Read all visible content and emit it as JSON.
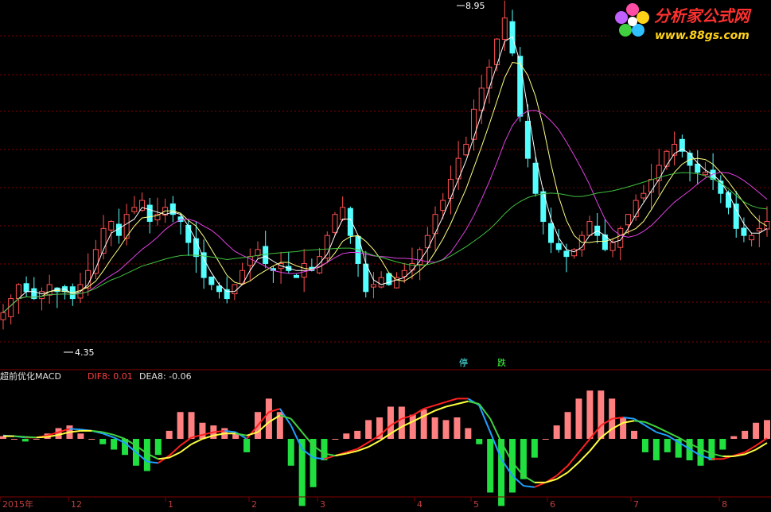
{
  "logo": {
    "title": "分析家公式网",
    "url": "www.88gs.com"
  },
  "price_panel": {
    "high_marker": "8.95",
    "low_marker": "4.35",
    "signals": [
      "停",
      "跌"
    ]
  },
  "macd_panel": {
    "indicator_name": "超前优化MACD",
    "dif_label": "DIF8: 0.01",
    "dea_label": "DEA8: -0.06"
  },
  "time_axis": {
    "labels": [
      "2015年",
      "12",
      "1",
      "2",
      "3",
      "4",
      "5",
      "6",
      "7",
      "8"
    ]
  },
  "colors": {
    "background": "#000000",
    "grid": "#800000",
    "up_candle": "#ff5050",
    "down_candle": "#54ffff",
    "ma_fast": "#ffffff",
    "ma_mid": "#ffff80",
    "ma_slow": "#e040e0",
    "ma_long": "#40c040",
    "dif_up": "#ff2020",
    "dif_down": "#20a0ff",
    "dea_up": "#ffff40",
    "dea_down": "#40d040",
    "hist_pos": "#ff8080",
    "hist_neg": "#20e040"
  },
  "chart_data": {
    "type": "line",
    "title": "",
    "price_extremes": {
      "high": 8.95,
      "low": 4.35
    },
    "price_close_approx": [
      4.7,
      4.9,
      5.1,
      5.0,
      4.9,
      5.0,
      5.1,
      5.0,
      5.0,
      4.9,
      5.1,
      5.3,
      5.6,
      5.9,
      6.0,
      5.8,
      6.1,
      6.2,
      6.3,
      6.0,
      6.1,
      6.2,
      6.1,
      6.0,
      5.7,
      5.5,
      5.2,
      5.1,
      5.0,
      4.9,
      5.1,
      5.3,
      5.5,
      5.6,
      5.4,
      5.3,
      5.4,
      5.3,
      5.2,
      5.4,
      5.3,
      5.5,
      5.8,
      6.1,
      6.2,
      5.8,
      5.4,
      5.0,
      5.1,
      5.2,
      5.1,
      5.2,
      5.3,
      5.4,
      5.6,
      5.8,
      6.1,
      6.3,
      6.6,
      6.9,
      7.1,
      7.6,
      7.9,
      8.2,
      8.6,
      8.9,
      8.4,
      7.5,
      6.9,
      6.4,
      6.0,
      5.7,
      5.6,
      5.5,
      5.6,
      5.8,
      6.0,
      5.8,
      5.6,
      5.7,
      5.9,
      6.1,
      6.3,
      6.4,
      6.6,
      6.8,
      7.0,
      7.1,
      7.0,
      6.8,
      6.7,
      6.7,
      6.6,
      6.4,
      6.2,
      5.9,
      5.8,
      5.8,
      5.9,
      6.0
    ],
    "dif_approx": [
      0.05,
      0.04,
      0.02,
      0.02,
      0.05,
      0.1,
      0.15,
      0.14,
      0.12,
      0.08,
      0.02,
      -0.06,
      -0.2,
      -0.34,
      -0.36,
      -0.25,
      -0.1,
      0.02,
      0.06,
      0.1,
      0.12,
      0.1,
      0.0,
      0.2,
      0.4,
      0.45,
      0.2,
      -0.15,
      -0.28,
      -0.3,
      -0.25,
      -0.2,
      -0.15,
      -0.05,
      0.05,
      0.2,
      0.3,
      0.35,
      0.45,
      0.5,
      0.55,
      0.6,
      0.6,
      0.5,
      0.1,
      -0.3,
      -0.55,
      -0.7,
      -0.72,
      -0.65,
      -0.55,
      -0.4,
      -0.2,
      0.0,
      0.2,
      0.3,
      0.32,
      0.3,
      0.2,
      0.1,
      0.05,
      -0.05,
      -0.15,
      -0.25,
      -0.3,
      -0.3,
      -0.25,
      -0.2,
      -0.1,
      0.01
    ],
    "dea_approx": [
      0.04,
      0.04,
      0.03,
      0.02,
      0.03,
      0.06,
      0.1,
      0.12,
      0.12,
      0.1,
      0.06,
      0.0,
      -0.1,
      -0.22,
      -0.3,
      -0.28,
      -0.2,
      -0.08,
      0.0,
      0.05,
      0.08,
      0.08,
      0.05,
      0.1,
      0.25,
      0.35,
      0.3,
      0.1,
      -0.1,
      -0.22,
      -0.25,
      -0.22,
      -0.18,
      -0.12,
      -0.03,
      0.08,
      0.18,
      0.26,
      0.34,
      0.42,
      0.48,
      0.52,
      0.56,
      0.52,
      0.3,
      -0.05,
      -0.35,
      -0.55,
      -0.65,
      -0.65,
      -0.6,
      -0.5,
      -0.35,
      -0.18,
      0.02,
      0.15,
      0.24,
      0.27,
      0.25,
      0.18,
      0.1,
      0.02,
      -0.07,
      -0.15,
      -0.22,
      -0.26,
      -0.26,
      -0.23,
      -0.16,
      -0.06
    ],
    "x_labels": [
      "2015年",
      "12",
      "1",
      "2",
      "3",
      "4",
      "5",
      "6",
      "7",
      "8"
    ]
  }
}
